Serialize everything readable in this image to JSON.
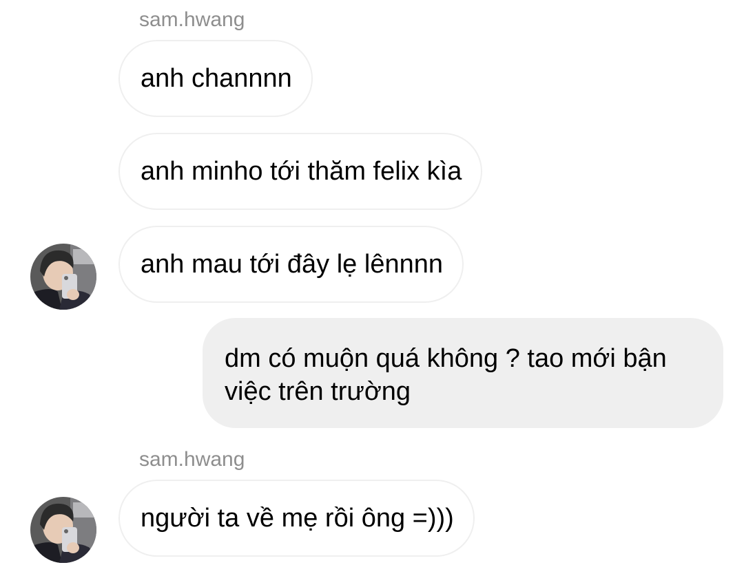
{
  "thread": {
    "messages": [
      {
        "sender": "sam.hwang",
        "text": "anh channnn"
      },
      {
        "text": "anh minho tới thăm felix kìa"
      },
      {
        "text": "anh mau tới đây lẹ lênnnn"
      },
      {
        "text": "dm có muộn quá không ? tao mới bận việc trên trường"
      },
      {
        "sender": "sam.hwang",
        "text": "người ta về mẹ rồi ông =)))"
      }
    ]
  },
  "colors": {
    "sender_label": "#8e8e8e",
    "incoming_border": "#efefef",
    "outgoing_background": "#efefef"
  },
  "icons": {
    "avatar": "profile-photo"
  }
}
